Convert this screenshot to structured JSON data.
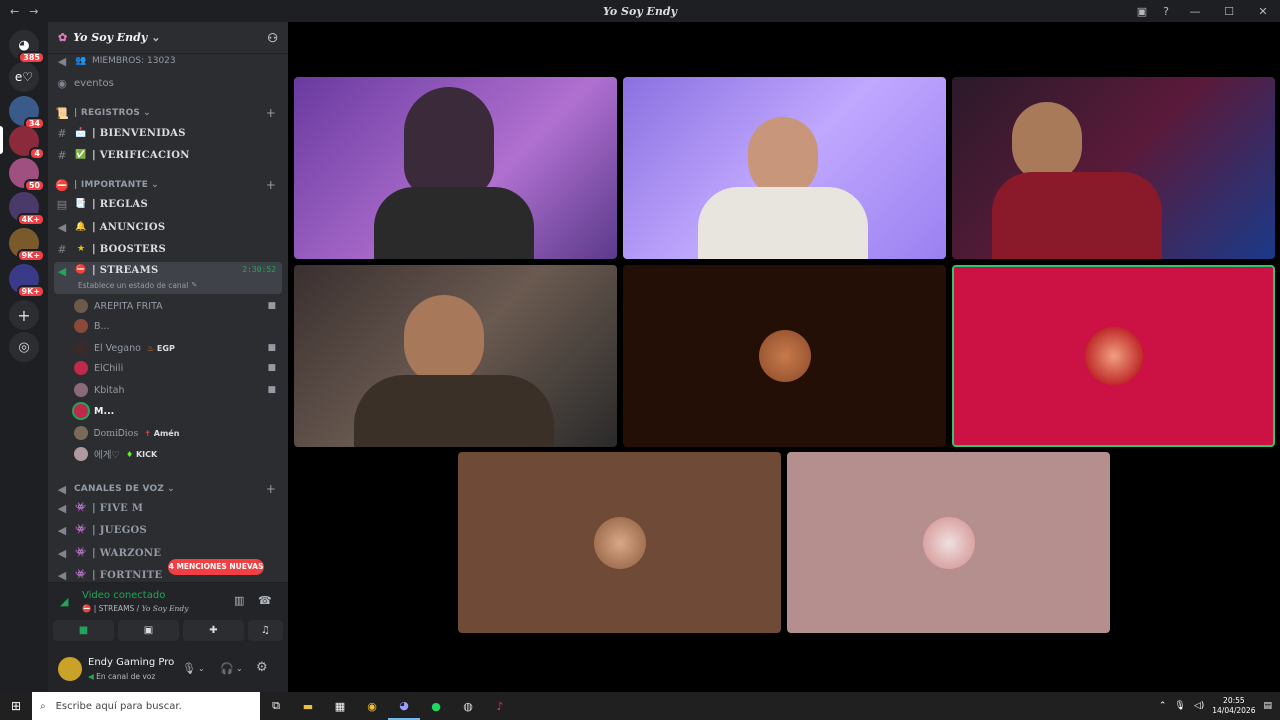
{
  "window": {
    "title": "Yo Soy Endy",
    "back_icon": "←",
    "forward_icon": "→"
  },
  "server_rail": {
    "items": [
      {
        "name": "discord-home",
        "badge": "385",
        "color": "#5865f2"
      },
      {
        "name": "server-e",
        "label": "e♡",
        "color": "#2b2d31"
      },
      {
        "name": "server-folder-1",
        "badge": "34",
        "color": "#3a5a8a"
      },
      {
        "name": "server-yo-soy-endy",
        "badge": "4",
        "color": "#8a2a3a"
      },
      {
        "name": "server-3",
        "badge": "50",
        "color": "#a05080"
      },
      {
        "name": "server-folder-2",
        "badge": "4K+",
        "color": "#4a3a6a"
      },
      {
        "name": "server-5",
        "badge": "9K+",
        "color": "#7a5a2a"
      },
      {
        "name": "server-6",
        "badge": "9K+",
        "color": "#3a3a8a"
      }
    ]
  },
  "sidebar": {
    "server_name": "Yo Soy Endy",
    "members_label": "MIEMBROS: 13023",
    "events_label": "eventos",
    "categories": {
      "registros": "| REGISTROS",
      "importante": "| IMPORTANTE",
      "voz": "CANALES DE VOZ"
    },
    "channels": {
      "bienvenidas": "| BIENVENIDAS",
      "verificacion": "| VERIFICACION",
      "reglas": "| REGLAS",
      "anuncios": "| ANUNCIOS",
      "boosters": "| BOOSTERS",
      "streams": "| STREAMS",
      "streams_status": "Establece un estado de canal",
      "streams_timer": "2:30:52",
      "five_m": "| FIVE M",
      "juegos": "| JUEGOS",
      "warzone": "| WARZONE",
      "fortnite": "| FORTNITE"
    },
    "members": [
      {
        "name": "AREPITA FRITA",
        "camera": true,
        "tag": ""
      },
      {
        "name": "B...",
        "camera": false,
        "tag": ""
      },
      {
        "name": "El Vegano",
        "camera": true,
        "tag": "EGP"
      },
      {
        "name": "ElChili",
        "camera": true,
        "tag": ""
      },
      {
        "name": "Kbitah",
        "camera": true,
        "tag": ""
      },
      {
        "name": "M...",
        "camera": false,
        "tag": ""
      },
      {
        "name": "ᎠomiᎠios",
        "camera": false,
        "tag": "Amén"
      },
      {
        "name": "에게♡",
        "camera": false,
        "tag": "KICK"
      }
    ],
    "mentions_pill": "4 MENCIONES NUEVAS"
  },
  "voice_panel": {
    "status": "Video conectado",
    "channel": "| STREAMS / ",
    "server": "Yo Soy Endy"
  },
  "user_panel": {
    "name": "Endy Gaming Pro",
    "status": "En canal de voz"
  },
  "taskbar": {
    "search_placeholder": "Escribe aquí para buscar.",
    "time": "20:55",
    "date": "14/04/2026"
  },
  "colors": {
    "discord_green": "#23a559",
    "mention_red": "#f23f43",
    "tile_speaking_border": "#2dc770"
  }
}
